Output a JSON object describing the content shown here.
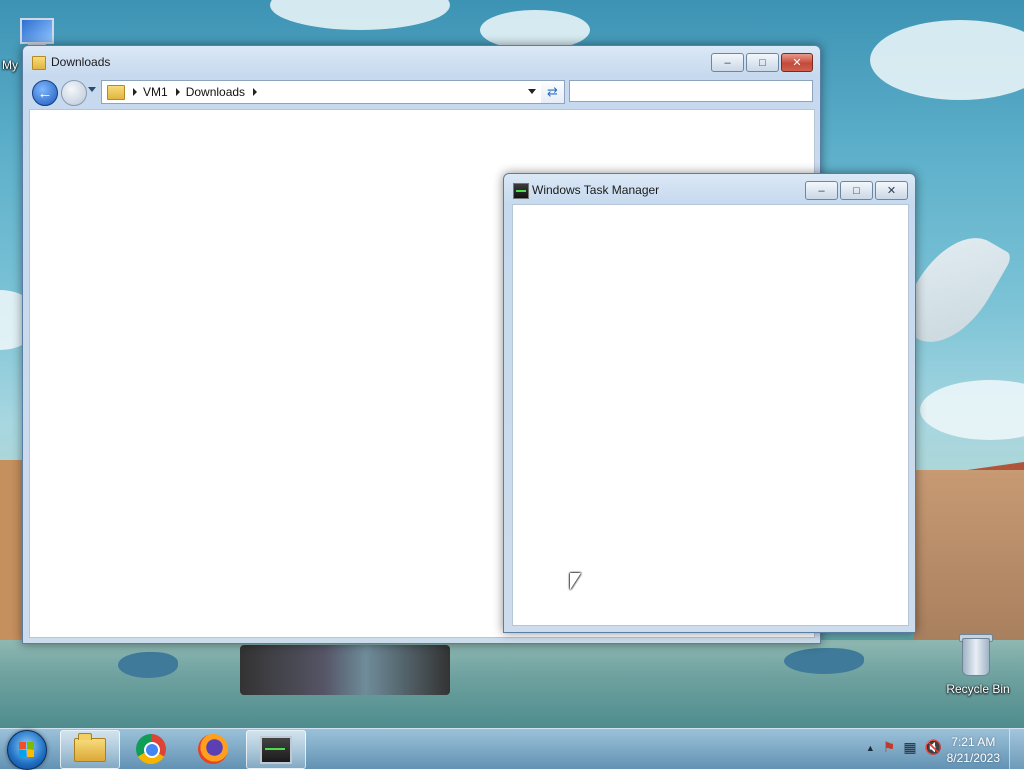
{
  "desktop": {
    "icons": [
      {
        "label": "My",
        "icon": "computer-icon"
      },
      {
        "label": "Recycle Bin",
        "icon": "recycle-bin-icon"
      }
    ]
  },
  "explorer": {
    "title": "Downloads",
    "icon": "folder-icon",
    "buttons": {
      "minimize": "–",
      "maximize": "□",
      "close": "✕"
    },
    "nav": {
      "back": "←"
    },
    "address": {
      "crumbs": [
        "VM1",
        "Downloads"
      ]
    },
    "refresh_glyph": "⇄",
    "search": {
      "value": "",
      "placeholder": ""
    }
  },
  "taskmgr": {
    "title": "Windows Task Manager",
    "icon": "task-manager-icon",
    "buttons": {
      "minimize": "–",
      "maximize": "□",
      "close": "✕"
    }
  },
  "taskbar": {
    "pinned": [
      {
        "name": "Windows Explorer",
        "icon": "explorer-icon",
        "active": true
      },
      {
        "name": "Google Chrome",
        "icon": "chrome-icon",
        "active": false
      },
      {
        "name": "Firefox",
        "icon": "firefox-icon",
        "active": false
      },
      {
        "name": "Windows Task Manager",
        "icon": "task-manager-icon",
        "active": true
      }
    ],
    "tray": {
      "show_hidden": "▲",
      "action_center": "⚑",
      "network": "▦",
      "volume": "🔇"
    },
    "clock": {
      "time": "7:21 AM",
      "date": "8/21/2023"
    }
  },
  "colors": {
    "accent": "#1f6fc2",
    "close": "#c44a3a",
    "taskbar": "#5a8caf"
  }
}
